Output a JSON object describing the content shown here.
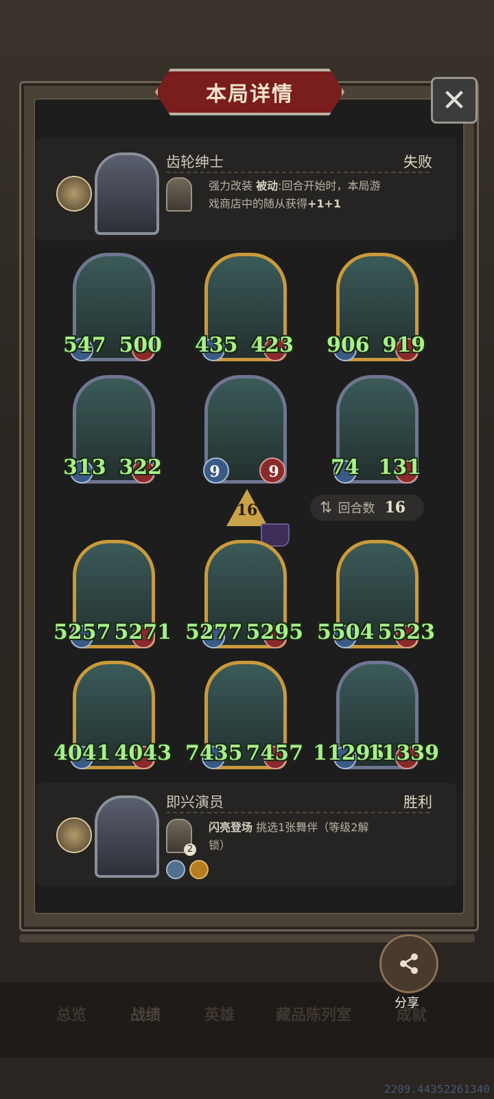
{
  "title": "本局详情",
  "close_label": "✕",
  "top_hero": {
    "name": "齿轮绅士",
    "result": "失败",
    "skill_name": "强力改装",
    "skill_type": "被动",
    "skill_desc_1": ":回合开始时，本局游",
    "skill_desc_2": "戏商店中的随从获得",
    "skill_bonus": "+1+1"
  },
  "top_units": [
    {
      "atk": "547",
      "hp": "500"
    },
    {
      "atk": "435",
      "hp": "423"
    },
    {
      "atk": "906",
      "hp": "919"
    },
    {
      "atk": "313",
      "hp": "322"
    },
    {
      "atk": "9",
      "hp": "9"
    },
    {
      "atk": "74",
      "hp": "131"
    }
  ],
  "turn_indicator": "16",
  "round": {
    "label": "回合数",
    "value": "16"
  },
  "bottom_units": [
    {
      "atk": "5257",
      "hp": "5271"
    },
    {
      "atk": "5277",
      "hp": "5295"
    },
    {
      "atk": "5504",
      "hp": "5523"
    },
    {
      "atk": "4041",
      "hp": "4043"
    },
    {
      "atk": "7435",
      "hp": "7457"
    },
    {
      "atk": "11295",
      "hp": "11339"
    }
  ],
  "bottom_hero": {
    "name": "即兴演员",
    "result": "胜利",
    "skill_name": "闪亮登场",
    "skill_desc_1": "挑选1张舞伴（等级2解",
    "skill_desc_2": "锁）",
    "skill_level": "2"
  },
  "share_label": "分享",
  "nav": [
    "总览",
    "战绩",
    "英雄",
    "藏品陈列室",
    "成就"
  ],
  "build_id": "2209.44352261340",
  "colors": {
    "stat_green": "#a8f08a",
    "banner_red": "#7a1d1d",
    "frame_gold": "#c99a3c"
  }
}
